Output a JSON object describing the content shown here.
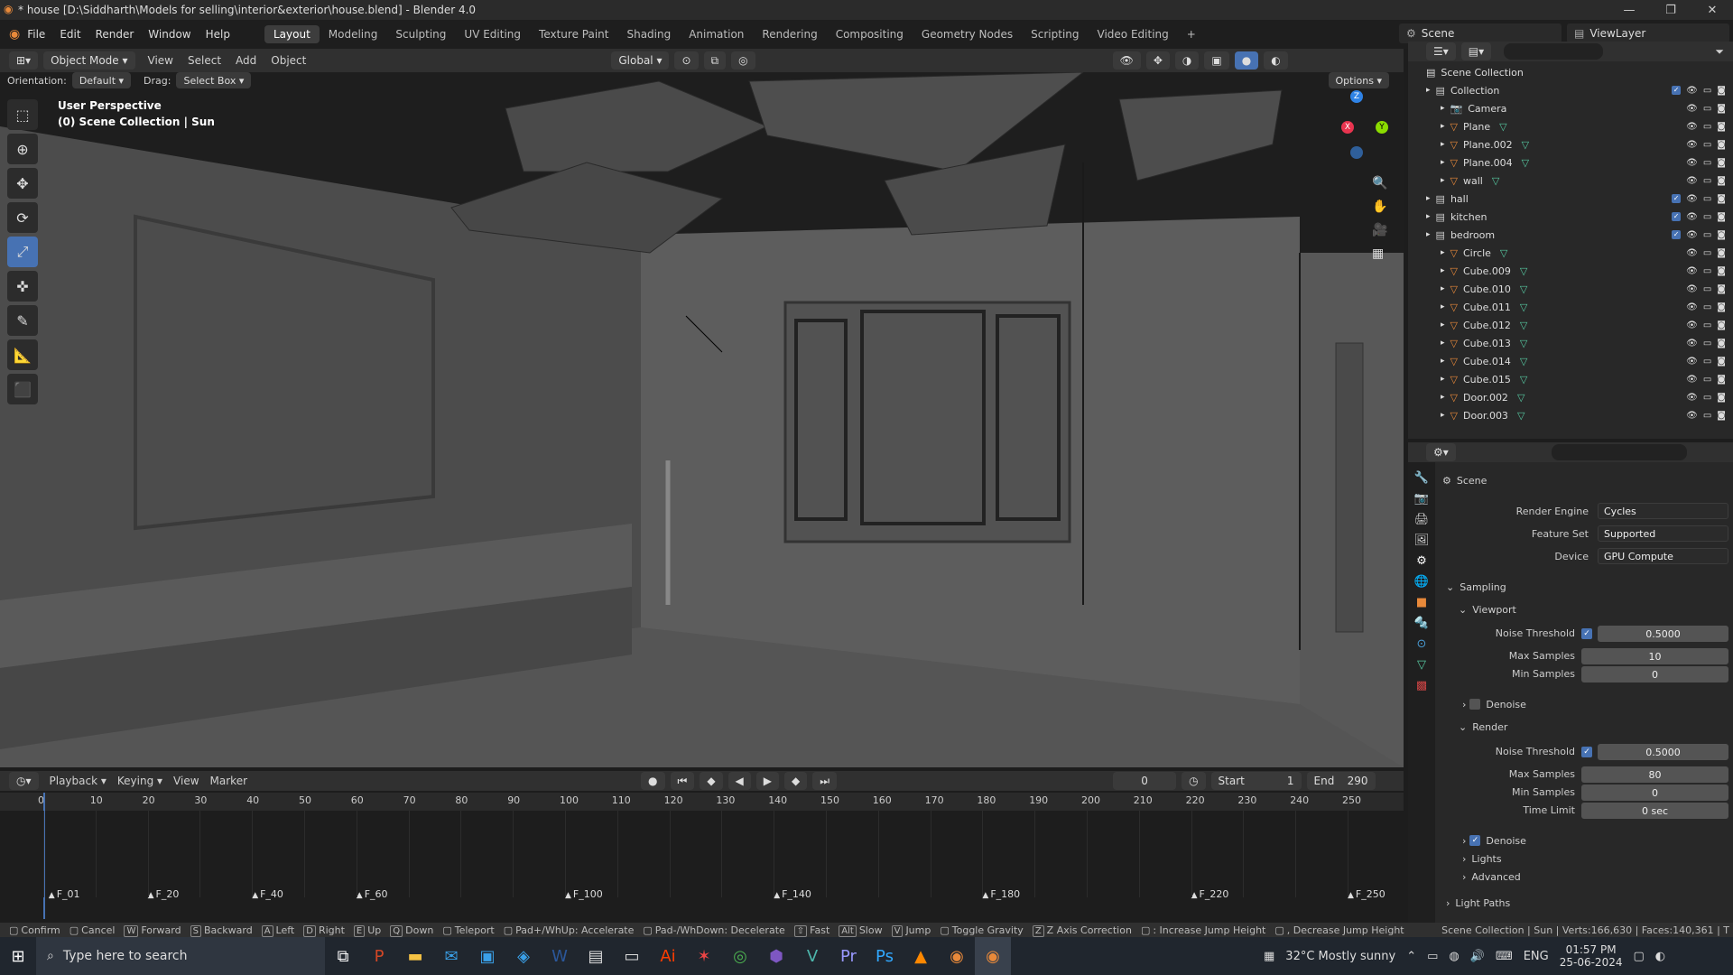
{
  "titlebar": {
    "title": "* house [D:\\Siddharth\\Models for selling\\interior&exterior\\house.blend] - Blender 4.0"
  },
  "menu": [
    "File",
    "Edit",
    "Render",
    "Window",
    "Help"
  ],
  "workspaces": [
    "Layout",
    "Modeling",
    "Sculpting",
    "UV Editing",
    "Texture Paint",
    "Shading",
    "Animation",
    "Rendering",
    "Compositing",
    "Geometry Nodes",
    "Scripting",
    "Video Editing"
  ],
  "scene_name": "Scene",
  "view_layer": "ViewLayer",
  "viewport_header": {
    "mode": "Object Mode",
    "view": "View",
    "select": "Select",
    "add": "Add",
    "object": "Object",
    "transform": "Global",
    "options": "Options"
  },
  "tool_settings": {
    "orientation_label": "Orientation:",
    "orientation": "Default",
    "drag_label": "Drag:",
    "drag": "Select Box"
  },
  "viewport": {
    "line1": "User Perspective",
    "line2": "(0) Scene Collection | Sun"
  },
  "outliner": {
    "root": "Scene Collection",
    "rows": [
      {
        "name": "Collection",
        "level": 0,
        "type": "collection"
      },
      {
        "name": "Camera",
        "level": 1,
        "type": "camera"
      },
      {
        "name": "Plane",
        "level": 1,
        "type": "mesh"
      },
      {
        "name": "Plane.002",
        "level": 1,
        "type": "mesh"
      },
      {
        "name": "Plane.004",
        "level": 1,
        "type": "mesh"
      },
      {
        "name": "wall",
        "level": 1,
        "type": "mesh"
      },
      {
        "name": "hall",
        "level": 0,
        "type": "collection"
      },
      {
        "name": "kitchen",
        "level": 0,
        "type": "collection"
      },
      {
        "name": "bedroom",
        "level": 0,
        "type": "collection"
      },
      {
        "name": "Circle",
        "level": 1,
        "type": "mesh"
      },
      {
        "name": "Cube.009",
        "level": 1,
        "type": "mesh"
      },
      {
        "name": "Cube.010",
        "level": 1,
        "type": "mesh"
      },
      {
        "name": "Cube.011",
        "level": 1,
        "type": "mesh"
      },
      {
        "name": "Cube.012",
        "level": 1,
        "type": "mesh"
      },
      {
        "name": "Cube.013",
        "level": 1,
        "type": "mesh"
      },
      {
        "name": "Cube.014",
        "level": 1,
        "type": "mesh"
      },
      {
        "name": "Cube.015",
        "level": 1,
        "type": "mesh"
      },
      {
        "name": "Door.002",
        "level": 1,
        "type": "mesh"
      },
      {
        "name": "Door.003",
        "level": 1,
        "type": "mesh"
      }
    ]
  },
  "properties": {
    "context": "Scene",
    "render_engine_label": "Render Engine",
    "render_engine": "Cycles",
    "feature_set_label": "Feature Set",
    "feature_set": "Supported",
    "device_label": "Device",
    "device": "GPU Compute",
    "sampling": "Sampling",
    "viewport": "Viewport",
    "vp_noise_label": "Noise Threshold",
    "vp_noise": "0.5000",
    "vp_max_label": "Max Samples",
    "vp_max": "10",
    "vp_min_label": "Min Samples",
    "vp_min": "0",
    "denoise": "Denoise",
    "render": "Render",
    "r_noise_label": "Noise Threshold",
    "r_noise": "0.5000",
    "r_max_label": "Max Samples",
    "r_max": "80",
    "r_min_label": "Min Samples",
    "r_min": "0",
    "r_time_label": "Time Limit",
    "r_time": "0 sec",
    "r_denoise": "Denoise",
    "lights": "Lights",
    "advanced": "Advanced",
    "light_paths": "Light Paths"
  },
  "timeline": {
    "playback": "Playback",
    "keying": "Keying",
    "view": "View",
    "marker": "Marker",
    "current": "0",
    "start_label": "Start",
    "start": "1",
    "end_label": "End",
    "end": "290",
    "ticks": [
      "0",
      "10",
      "20",
      "30",
      "40",
      "50",
      "60",
      "70",
      "80",
      "90",
      "100",
      "110",
      "120",
      "130",
      "140",
      "150",
      "160",
      "170",
      "180",
      "190",
      "200",
      "210",
      "220",
      "230",
      "240",
      "250"
    ],
    "markers": [
      "F_01",
      "F_20",
      "F_40",
      "F_60",
      "F_100",
      "F_140",
      "F_180",
      "F_220",
      "F_250"
    ]
  },
  "statusbar": {
    "items": [
      "Confirm",
      "Cancel",
      "Forward",
      "Backward",
      "Left",
      "Right",
      "Up",
      "Down",
      "Teleport",
      "Pad+/WhUp: Accelerate",
      "Pad-/WhDown: Decelerate",
      "Fast",
      "Slow",
      "Jump",
      "Toggle Gravity",
      "Z Axis Correction",
      ": Increase Jump Height",
      ", Decrease Jump Height"
    ],
    "keys": [
      "",
      "",
      "W",
      "S",
      "A",
      "D",
      "E",
      "Q",
      "",
      "",
      "",
      "⇧",
      "Alt",
      "V",
      "",
      "Z",
      "",
      ""
    ],
    "stats": "Scene Collection | Sun | Verts:166,630 | Faces:140,361 | T"
  },
  "taskbar": {
    "search_placeholder": "Type here to search",
    "weather": "32°C  Mostly sunny",
    "lang": "ENG",
    "time": "01:57 PM",
    "date": "25-06-2024"
  },
  "colors": {
    "accent": "#4772b3",
    "mesh_icon": "#e8893a",
    "vertex_icon": "#56c7a0",
    "axis_x": "#e8344f",
    "axis_y": "#8bdc00",
    "axis_z": "#2f83e6"
  }
}
